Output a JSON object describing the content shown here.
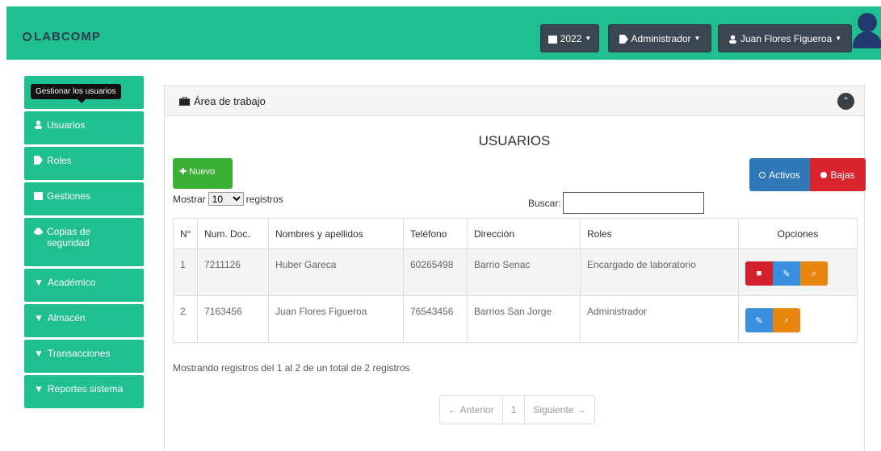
{
  "brand": {
    "name": "LABCOMP"
  },
  "topbar": {
    "year_label": "2022",
    "role_label": "Administrador",
    "user_label": "Juan Flores Figueroa"
  },
  "sidebar": {
    "tooltip": "Gestionar los usuarios",
    "items": [
      {
        "label": "Usuarios",
        "icon": "user-icon"
      },
      {
        "label": "Roles",
        "icon": "tag-icon"
      },
      {
        "label": "Gestiones",
        "icon": "calendar-icon"
      },
      {
        "label": "Copias de seguridad",
        "icon": "cloud-icon"
      },
      {
        "label": "Académico",
        "icon": "chevron-down-icon"
      },
      {
        "label": "Almacén",
        "icon": "chevron-down-icon"
      },
      {
        "label": "Transacciones",
        "icon": "chevron-down-icon"
      },
      {
        "label": "Reportes sistema",
        "icon": "chevron-down-icon"
      }
    ]
  },
  "panel": {
    "heading": "Área de trabajo",
    "title": "USUARIOS",
    "new_label": "Nuevo",
    "active_label": "Activos",
    "inactive_label": "Bajas",
    "show_label": "Mostrar",
    "show_value": "10",
    "records_label": "registros",
    "search_label": "Buscar:"
  },
  "table": {
    "headers": [
      "N°",
      "Num. Doc.",
      "Nombres y apellidos",
      "Teléfono",
      "Dirección",
      "Roles",
      "Opciones"
    ],
    "rows": [
      {
        "n": "1",
        "doc": "7211126",
        "name": "Huber Gareca",
        "phone": "60265498",
        "address": "Barrio Senac",
        "role": "Encargado de laboratorio"
      },
      {
        "n": "2",
        "doc": "7163456",
        "name": "Juan Flores Figueroa",
        "phone": "76543456",
        "address": "Barrios San Jorge",
        "role": "Administrador"
      }
    ]
  },
  "footer": {
    "info": "Mostrando registros del 1 al 2 de un total de 2 registros",
    "prev": "← Anterior",
    "page": "1",
    "next": "Siguiente →"
  },
  "colors": {
    "accent": "#1fbf8f",
    "dark": "#3a4651",
    "new": "#3cb034",
    "active": "#2f79b8",
    "danger": "#d9232d",
    "edit": "#3b8fe0",
    "view": "#e8850e"
  }
}
